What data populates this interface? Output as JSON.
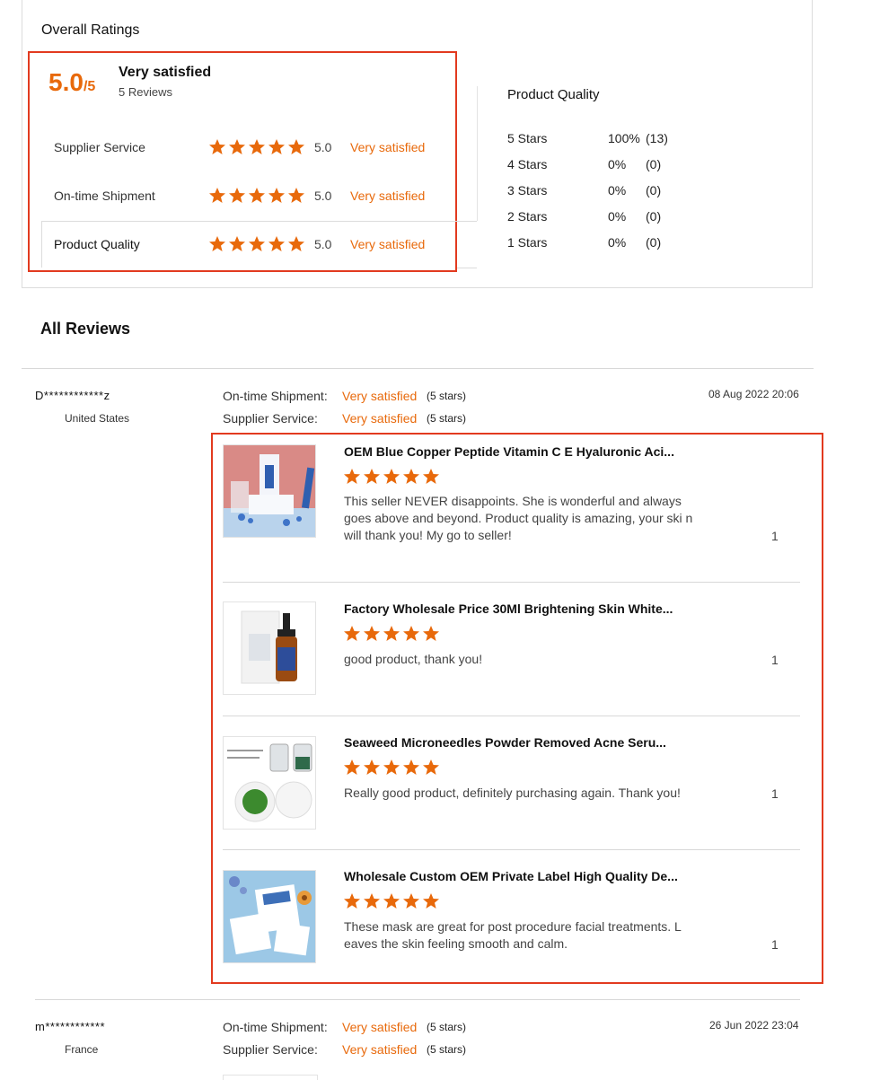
{
  "overall": {
    "heading": "Overall Ratings",
    "score": "5.0",
    "score_suffix": "/5",
    "summary_label": "Very satisfied",
    "review_count": "5 Reviews",
    "metrics": [
      {
        "label": "Supplier Service",
        "value": "5.0",
        "sentiment": "Very satisfied",
        "stars": 5
      },
      {
        "label": "On-time Shipment",
        "value": "5.0",
        "sentiment": "Very satisfied",
        "stars": 5
      },
      {
        "label": "Product Quality",
        "value": "5.0",
        "sentiment": "Very satisfied",
        "stars": 5
      }
    ]
  },
  "product_quality": {
    "heading": "Product Quality",
    "rows": [
      {
        "label": "5  Stars",
        "percent": "100%",
        "count": "(13)"
      },
      {
        "label": "4  Stars",
        "percent": "0%",
        "count": "(0)"
      },
      {
        "label": "3  Stars",
        "percent": "0%",
        "count": "(0)"
      },
      {
        "label": "2  Stars",
        "percent": "0%",
        "count": "(0)"
      },
      {
        "label": "1  Stars",
        "percent": "0%",
        "count": "(0)"
      }
    ]
  },
  "all_reviews": {
    "heading": "All Reviews",
    "reviewers": [
      {
        "user": "D************z",
        "country": "United States",
        "date": "08 Aug 2022 20:06",
        "shipment_label": "On-time Shipment:",
        "shipment_value": "Very satisfied",
        "shipment_stars": "(5 stars)",
        "service_label": "Supplier Service:",
        "service_value": "Very satisfied",
        "service_stars": "(5 stars)",
        "items": [
          {
            "title": "OEM Blue Copper Peptide Vitamin C E Hyaluronic Aci...",
            "text": "This seller NEVER disappoints. She is wonderful and always goes above and beyond. Product quality is amazing, your ski n will thank you! My go to seller!",
            "likes": "1",
            "stars": 5
          },
          {
            "title": "Factory Wholesale Price 30Ml Brightening Skin White...",
            "text": "good product, thank you!",
            "likes": "1",
            "stars": 5
          },
          {
            "title": "Seaweed Microneedles Powder Removed Acne Seru...",
            "text": "Really good product, definitely purchasing again. Thank you!",
            "likes": "1",
            "stars": 5
          },
          {
            "title": "Wholesale Custom OEM Private Label High Quality De...",
            "text": "These mask are great for post procedure facial treatments. L eaves the skin feeling smooth and calm.",
            "likes": "1",
            "stars": 5
          }
        ]
      },
      {
        "user": "m************",
        "country": "France",
        "date": "26 Jun 2022 23:04",
        "shipment_label": "On-time Shipment:",
        "shipment_value": "Very satisfied",
        "shipment_stars": "(5 stars)",
        "service_label": "Supplier Service:",
        "service_value": "Very satisfied",
        "service_stars": "(5 stars)"
      }
    ]
  },
  "colors": {
    "accent": "#e8690b",
    "highlight": "#e23a1f"
  }
}
